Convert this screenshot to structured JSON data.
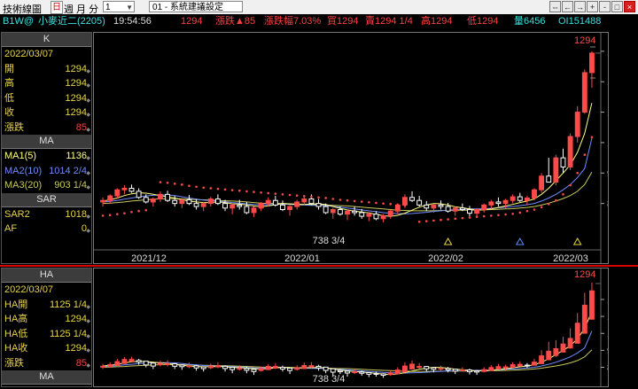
{
  "titlebar": {
    "app_title": "技術線圖",
    "day_button": "日",
    "period_label": "週 月 分",
    "num_value": "1",
    "system_setting": "01 - 系統建議設定"
  },
  "window_buttons": [
    "⇔",
    "←",
    "→",
    "+",
    "-",
    "□",
    "×"
  ],
  "info": {
    "symbol": "B1W@",
    "name": "小麥近二(2205)",
    "time": "19:54:56",
    "price": "1294",
    "change_label": "漲跌▲85",
    "change_pct_label": "漲跌幅7.03%",
    "bid_label": "買1294",
    "ask_label": "賣1294 1/4",
    "high_label": "高1294",
    "low_label": "低1294",
    "volume_label": "量6456",
    "oi_label": "OI151488"
  },
  "colors": {
    "up": "#ff4a4a",
    "down": "#ffffff",
    "ma1": "#ffff80",
    "ma2": "#6f8cff",
    "ma3": "#c8c860",
    "sar": "#ff4a4a",
    "accent": "#e8d44a",
    "border_red": "#d00000"
  },
  "k_panel": {
    "title": "K",
    "date": "2022/03/07",
    "rows": [
      {
        "label": "開",
        "value": "1294",
        "red": false
      },
      {
        "label": "高",
        "value": "1294",
        "red": false
      },
      {
        "label": "低",
        "value": "1294",
        "red": false
      },
      {
        "label": "收",
        "value": "1294",
        "red": false
      },
      {
        "label": "漲跌",
        "value": "85",
        "red": true
      }
    ]
  },
  "ma_panel": {
    "title": "MA",
    "rows": [
      {
        "label": "MA1(5)",
        "value": "1136",
        "color": "#ffff80"
      },
      {
        "label": "MA2(10)",
        "value": "1014 2/4",
        "color": "#6f8cff"
      },
      {
        "label": "MA3(20)",
        "value": "903 1/4",
        "color": "#c8c860"
      }
    ]
  },
  "sar_panel": {
    "title": "SAR",
    "rows": [
      {
        "label": "SAR2",
        "value": "1018"
      },
      {
        "label": "AF",
        "value": "0"
      }
    ]
  },
  "ha_panel": {
    "title": "HA",
    "date": "2022/03/07",
    "rows": [
      {
        "label": "HA開",
        "value": "1125 1/4",
        "red": false
      },
      {
        "label": "HA高",
        "value": "1294",
        "red": false
      },
      {
        "label": "HA低",
        "value": "1125 1/4",
        "red": false
      },
      {
        "label": "HA收",
        "value": "1294",
        "red": false
      },
      {
        "label": "漲跌",
        "value": "85",
        "red": true
      }
    ]
  },
  "ma_panel2": {
    "title": "MA"
  },
  "chart_data": [
    {
      "type": "candlestick",
      "y_ticks": [
        "1300",
        "1200",
        "1100",
        "1000",
        "900",
        "800"
      ],
      "ylim": [
        700,
        1320
      ],
      "last_price_label": "1294",
      "low_annotation": "738 3/4",
      "x_labels": [
        "2021/12",
        "2022/01",
        "2022/02",
        "2022/03"
      ],
      "ohlc": [
        [
          805,
          820,
          790,
          810
        ],
        [
          810,
          830,
          800,
          825
        ],
        [
          825,
          850,
          815,
          845
        ],
        [
          845,
          860,
          830,
          850
        ],
        [
          850,
          862,
          835,
          840
        ],
        [
          840,
          850,
          815,
          820
        ],
        [
          820,
          830,
          800,
          805
        ],
        [
          805,
          820,
          790,
          815
        ],
        [
          815,
          840,
          805,
          830
        ],
        [
          830,
          842,
          805,
          810
        ],
        [
          810,
          825,
          790,
          800
        ],
        [
          800,
          818,
          785,
          812
        ],
        [
          812,
          828,
          795,
          800
        ],
        [
          800,
          815,
          780,
          790
        ],
        [
          790,
          805,
          775,
          800
        ],
        [
          800,
          822,
          790,
          815
        ],
        [
          815,
          830,
          795,
          800
        ],
        [
          800,
          812,
          775,
          785
        ],
        [
          785,
          800,
          765,
          795
        ],
        [
          795,
          812,
          780,
          790
        ],
        [
          790,
          805,
          765,
          770
        ],
        [
          770,
          790,
          755,
          785
        ],
        [
          785,
          805,
          775,
          800
        ],
        [
          800,
          820,
          790,
          810
        ],
        [
          810,
          825,
          790,
          795
        ],
        [
          795,
          810,
          775,
          780
        ],
        [
          780,
          795,
          760,
          790
        ],
        [
          790,
          812,
          780,
          805
        ],
        [
          805,
          828,
          795,
          815
        ],
        [
          815,
          830,
          795,
          800
        ],
        [
          800,
          815,
          780,
          790
        ],
        [
          790,
          800,
          765,
          770
        ],
        [
          770,
          785,
          750,
          780
        ],
        [
          780,
          790,
          760,
          765
        ],
        [
          765,
          780,
          745,
          775
        ],
        [
          775,
          790,
          760,
          770
        ],
        [
          770,
          782,
          750,
          758
        ],
        [
          758,
          772,
          742,
          765
        ],
        [
          765,
          775,
          745,
          750
        ],
        [
          750,
          765,
          738,
          760
        ],
        [
          760,
          780,
          750,
          775
        ],
        [
          775,
          800,
          765,
          795
        ],
        [
          795,
          830,
          785,
          820
        ],
        [
          820,
          840,
          805,
          810
        ],
        [
          810,
          825,
          790,
          795
        ],
        [
          795,
          808,
          775,
          785
        ],
        [
          785,
          800,
          770,
          795
        ],
        [
          795,
          810,
          780,
          790
        ],
        [
          790,
          802,
          770,
          775
        ],
        [
          775,
          790,
          760,
          785
        ],
        [
          785,
          800,
          775,
          780
        ],
        [
          780,
          792,
          758,
          768
        ],
        [
          768,
          785,
          755,
          780
        ],
        [
          780,
          800,
          770,
          795
        ],
        [
          795,
          812,
          782,
          805
        ],
        [
          805,
          820,
          790,
          800
        ],
        [
          800,
          815,
          785,
          810
        ],
        [
          810,
          830,
          800,
          822
        ],
        [
          822,
          835,
          805,
          810
        ],
        [
          810,
          825,
          795,
          818
        ],
        [
          818,
          850,
          810,
          845
        ],
        [
          845,
          900,
          835,
          890
        ],
        [
          890,
          950,
          870,
          870
        ],
        [
          870,
          960,
          860,
          950
        ],
        [
          950,
          980,
          900,
          920
        ],
        [
          920,
          1030,
          910,
          1020
        ],
        [
          1020,
          1120,
          1000,
          1100
        ],
        [
          1100,
          1240,
          1095,
          1230
        ],
        [
          1230,
          1300,
          1180,
          1294
        ]
      ],
      "ma1": [
        808,
        812,
        818,
        826,
        832,
        835,
        834,
        830,
        826,
        822,
        818,
        812,
        808,
        805,
        803,
        803,
        805,
        803,
        799,
        798,
        795,
        792,
        790,
        792,
        796,
        800,
        798,
        797,
        797,
        798,
        799,
        797,
        790,
        784,
        779,
        775,
        772,
        769,
        764,
        760,
        758,
        761,
        768,
        778,
        788,
        795,
        800,
        799,
        795,
        789,
        786,
        782,
        779,
        779,
        782,
        787,
        792,
        797,
        803,
        808,
        815,
        830,
        850,
        875,
        900,
        927,
        968,
        1030,
        1130
      ],
      "ma2": [
        805,
        807,
        810,
        814,
        818,
        822,
        825,
        827,
        828,
        828,
        826,
        822,
        818,
        814,
        811,
        809,
        808,
        806,
        803,
        801,
        799,
        797,
        796,
        796,
        797,
        798,
        797,
        796,
        795,
        794,
        794,
        793,
        791,
        788,
        785,
        782,
        779,
        776,
        773,
        770,
        768,
        767,
        766,
        767,
        769,
        771,
        774,
        776,
        778,
        780,
        781,
        782,
        782,
        783,
        784,
        786,
        788,
        790,
        793,
        796,
        800,
        808,
        818,
        830,
        845,
        862,
        885,
        915,
        1014
      ],
      "ma3": [
        800,
        801,
        803,
        805,
        808,
        810,
        812,
        814,
        815,
        816,
        816,
        815,
        814,
        813,
        812,
        811,
        810,
        809,
        808,
        807,
        805,
        803,
        801,
        800,
        800,
        800,
        799,
        798,
        797,
        796,
        796,
        795,
        794,
        793,
        792,
        790,
        788,
        786,
        784,
        782,
        780,
        778,
        777,
        776,
        776,
        776,
        776,
        777,
        777,
        778,
        778,
        778,
        779,
        779,
        780,
        781,
        782,
        783,
        785,
        787,
        790,
        795,
        801,
        808,
        816,
        826,
        840,
        862,
        903
      ],
      "sar": [
        760,
        762,
        765,
        768,
        772,
        775,
        778,
        0,
        870,
        868,
        865,
        862,
        858,
        855,
        852,
        850,
        848,
        846,
        844,
        842,
        840,
        838,
        836,
        834,
        832,
        830,
        828,
        826,
        824,
        822,
        820,
        818,
        815,
        812,
        810,
        808,
        806,
        804,
        802,
        800,
        798,
        796,
        794,
        0,
        740,
        742,
        744,
        746,
        748,
        750,
        752,
        754,
        756,
        758,
        760,
        762,
        764,
        766,
        770,
        775,
        780,
        788,
        798,
        810,
        830,
        860,
        900,
        960,
        1018
      ],
      "markers": [
        {
          "index": 48,
          "color": "#e8d44a"
        },
        {
          "index": 58,
          "color": "#5a8cff"
        },
        {
          "index": 66,
          "color": "#e8d44a"
        }
      ]
    },
    {
      "type": "heikin-ashi",
      "y_ticks": [
        "1200",
        "1100",
        "1000",
        "900",
        "800"
      ],
      "ylim": [
        740,
        1320
      ],
      "last_price_label": "1294",
      "low_annotation": "738 3/4"
    }
  ]
}
